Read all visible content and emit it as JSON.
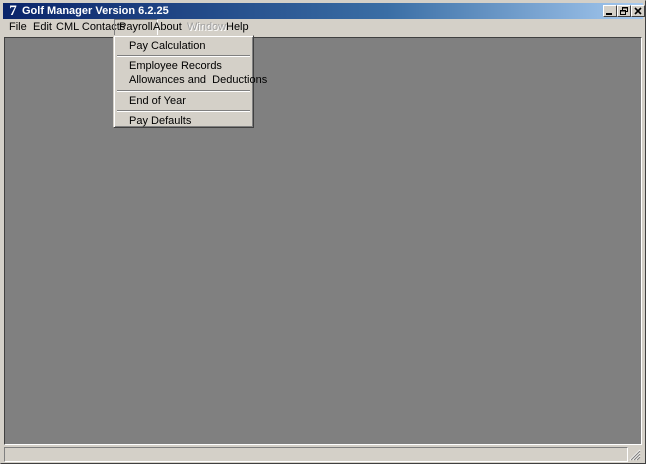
{
  "window": {
    "title": "Golf Manager Version 6.2.25",
    "app_icon_glyph": "7"
  },
  "menubar": {
    "items": [
      {
        "label": "File",
        "state": "normal"
      },
      {
        "label": "Edit",
        "state": "normal"
      },
      {
        "label": "CML Contacts",
        "state": "normal"
      },
      {
        "label": "Payroll",
        "state": "open"
      },
      {
        "label": "About",
        "state": "normal"
      },
      {
        "label": "Window",
        "state": "disabled"
      },
      {
        "label": "Help",
        "state": "normal"
      }
    ]
  },
  "payroll_menu": {
    "items": [
      {
        "label": "Pay Calculation"
      },
      {
        "label": "Employee Records"
      },
      {
        "label": "Allowances and  Deductions"
      },
      {
        "label": "End of Year"
      },
      {
        "label": "Pay Defaults"
      }
    ]
  },
  "statusbar": {
    "text": ""
  },
  "colors": {
    "titlebar_start": "#0a246a",
    "titlebar_end": "#a6caf0",
    "mdi_background": "#808080",
    "face": "#d4d0c8"
  }
}
